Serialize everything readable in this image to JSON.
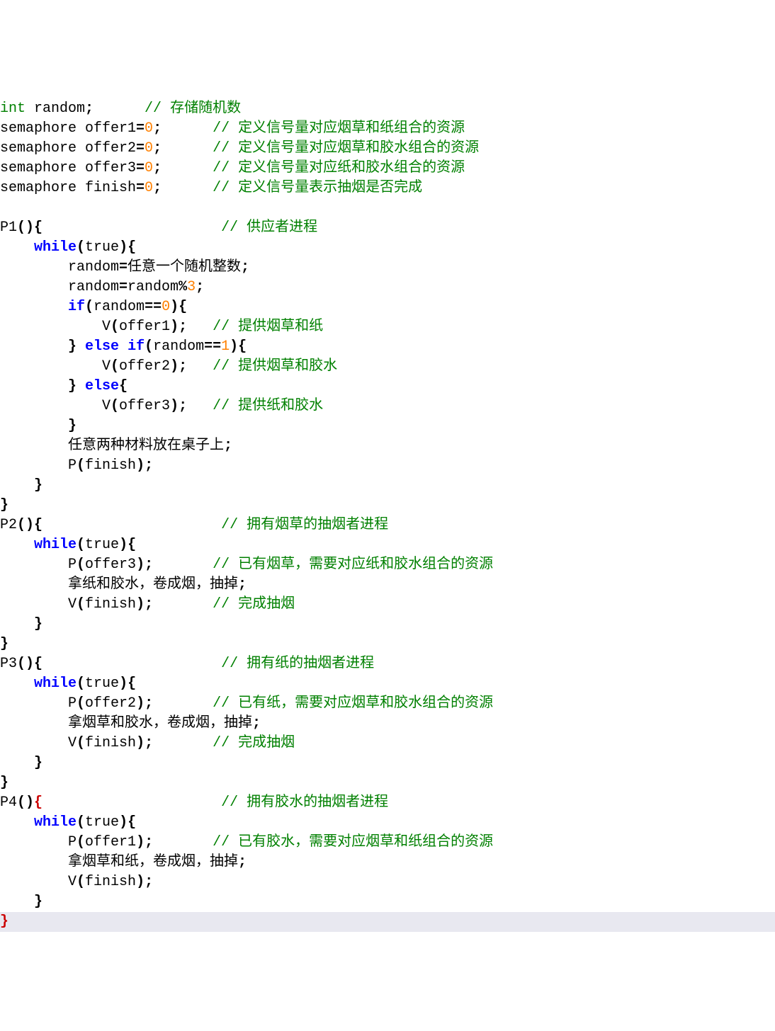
{
  "code": {
    "line01_a": "int",
    "line01_b": " random",
    "line01_c": ";",
    "line01_d": "      // 存储随机数",
    "line02_a": "semaphore offer1",
    "line02_b": "=",
    "line02_c": "0",
    "line02_d": ";",
    "line02_e": "      // 定义信号量对应烟草和纸组合的资源",
    "line03_a": "semaphore offer2",
    "line03_b": "=",
    "line03_c": "0",
    "line03_d": ";",
    "line03_e": "      // 定义信号量对应烟草和胶水组合的资源",
    "line04_a": "semaphore offer3",
    "line04_b": "=",
    "line04_c": "0",
    "line04_d": ";",
    "line04_e": "      // 定义信号量对应纸和胶水组合的资源",
    "line05_a": "semaphore finish",
    "line05_b": "=",
    "line05_c": "0",
    "line05_d": ";",
    "line05_e": "      // 定义信号量表示抽烟是否完成",
    "line06": "",
    "line07_a": "P1",
    "line07_b": "(){",
    "line07_c": "                     // 供应者进程",
    "line08_a": "    ",
    "line08_b": "while",
    "line08_c": "(",
    "line08_d": "true",
    "line08_e": "){",
    "line09_a": "        random",
    "line09_b": "=",
    "line09_c": "任意一个随机整数",
    "line09_d": ";",
    "line10_a": "        random",
    "line10_b": "=",
    "line10_c": "random",
    "line10_d": "%",
    "line10_e": "3",
    "line10_f": ";",
    "line11_a": "        ",
    "line11_b": "if",
    "line11_c": "(",
    "line11_d": "random",
    "line11_e": "==",
    "line11_f": "0",
    "line11_g": "){",
    "line12_a": "            V",
    "line12_b": "(",
    "line12_c": "offer1",
    "line12_d": ");",
    "line12_e": "   // 提供烟草和纸",
    "line13_a": "        ",
    "line13_b": "}",
    "line13_c": " ",
    "line13_d": "else",
    "line13_e": " ",
    "line13_f": "if",
    "line13_g": "(",
    "line13_h": "random",
    "line13_i": "==",
    "line13_j": "1",
    "line13_k": "){",
    "line14_a": "            V",
    "line14_b": "(",
    "line14_c": "offer2",
    "line14_d": ");",
    "line14_e": "   // 提供烟草和胶水",
    "line15_a": "        ",
    "line15_b": "}",
    "line15_c": " ",
    "line15_d": "else",
    "line15_e": "{",
    "line16_a": "            V",
    "line16_b": "(",
    "line16_c": "offer3",
    "line16_d": ");",
    "line16_e": "   // 提供纸和胶水",
    "line17_a": "        ",
    "line17_b": "}",
    "line18_a": "        任意两种材料放在桌子上",
    "line18_b": ";",
    "line19_a": "        P",
    "line19_b": "(",
    "line19_c": "finish",
    "line19_d": ");",
    "line20_a": "    ",
    "line20_b": "}",
    "line21_a": "}",
    "line22_a": "P2",
    "line22_b": "(){",
    "line22_c": "                     // 拥有烟草的抽烟者进程",
    "line23_a": "    ",
    "line23_b": "while",
    "line23_c": "(",
    "line23_d": "true",
    "line23_e": "){",
    "line24_a": "        P",
    "line24_b": "(",
    "line24_c": "offer3",
    "line24_d": ");",
    "line24_e": "       // 已有烟草，需要对应纸和胶水组合的资源",
    "line25_a": "        拿纸和胶水，卷成烟，抽掉",
    "line25_b": ";",
    "line26_a": "        V",
    "line26_b": "(",
    "line26_c": "finish",
    "line26_d": ");",
    "line26_e": "       // 完成抽烟",
    "line27_a": "    ",
    "line27_b": "}",
    "line28_a": "}",
    "line29_a": "P3",
    "line29_b": "(){",
    "line29_c": "                     // 拥有纸的抽烟者进程",
    "line30_a": "    ",
    "line30_b": "while",
    "line30_c": "(",
    "line30_d": "true",
    "line30_e": "){",
    "line31_a": "        P",
    "line31_b": "(",
    "line31_c": "offer2",
    "line31_d": ");",
    "line31_e": "       // 已有纸，需要对应烟草和胶水组合的资源",
    "line32_a": "        拿烟草和胶水，卷成烟，抽掉",
    "line32_b": ";",
    "line33_a": "        V",
    "line33_b": "(",
    "line33_c": "finish",
    "line33_d": ");",
    "line33_e": "       // 完成抽烟",
    "line34_a": "    ",
    "line34_b": "}",
    "line35_a": "}",
    "line36_a": "P4",
    "line36_b": "()",
    "line36_c": "{",
    "line36_d": "                     // 拥有胶水的抽烟者进程",
    "line37_a": "    ",
    "line37_b": "while",
    "line37_c": "(",
    "line37_d": "true",
    "line37_e": "){",
    "line38_a": "        P",
    "line38_b": "(",
    "line38_c": "offer1",
    "line38_d": ");",
    "line38_e": "       // 已有胶水，需要对应烟草和纸组合的资源",
    "line39_a": "        拿烟草和纸，卷成烟，抽掉",
    "line39_b": ";",
    "line40_a": "        V",
    "line40_b": "(",
    "line40_c": "finish",
    "line40_d": ");",
    "line41_a": "    ",
    "line41_b": "}",
    "line42_a": "}"
  }
}
